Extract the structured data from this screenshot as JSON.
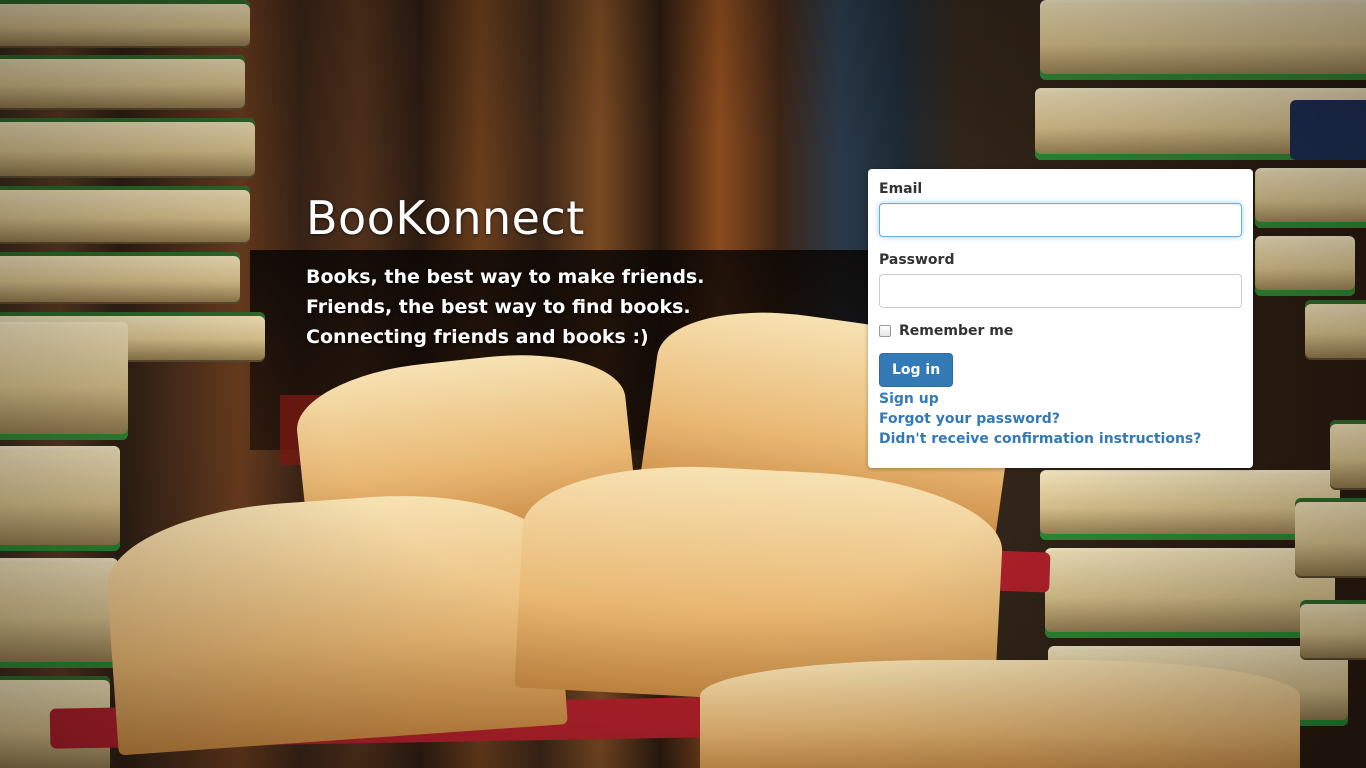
{
  "brand": {
    "title": "BooKonnect",
    "tagline": [
      "Books, the best way to make friends.",
      "Friends, the best way to find books.",
      "Connecting friends and books :)"
    ]
  },
  "login_form": {
    "email_label": "Email",
    "email_value": "",
    "password_label": "Password",
    "password_value": "",
    "remember_label": "Remember me",
    "remember_checked": false,
    "submit_label": "Log in",
    "links": {
      "sign_up": "Sign up",
      "forgot_password": "Forgot your password?",
      "confirmation": "Didn't receive confirmation instructions?"
    }
  },
  "colors": {
    "primary": "#337ab7",
    "link": "#337ab7",
    "focus_border": "#66afe9"
  },
  "background": {
    "description_icon": "books-background-image"
  }
}
